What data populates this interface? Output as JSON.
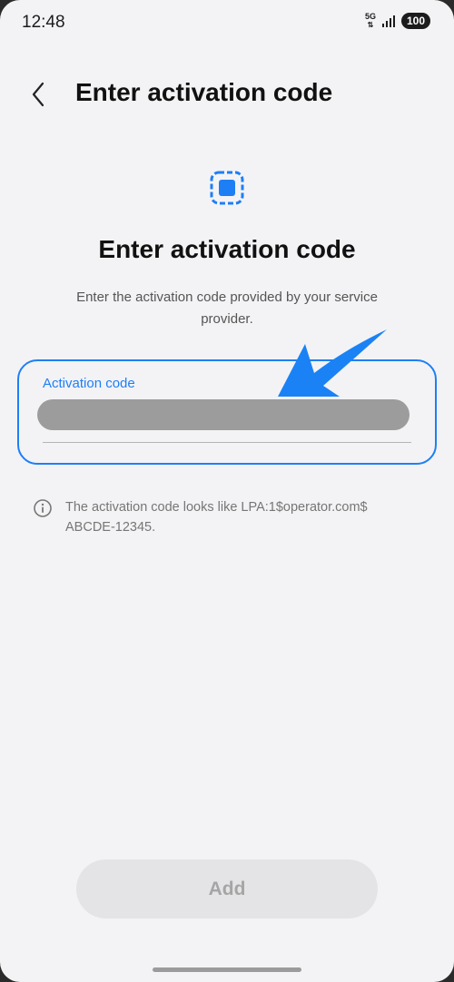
{
  "status_bar": {
    "time": "12:48",
    "network_type": "5G",
    "battery": "100"
  },
  "header": {
    "title": "Enter activation code"
  },
  "content": {
    "title": "Enter activation code",
    "description": "Enter the activation code provided by your service provider.",
    "input": {
      "label": "Activation code",
      "value": ""
    },
    "hint": {
      "line1": "The activation code looks like LPA:1$operator.com$",
      "line2": "ABCDE-12345."
    }
  },
  "footer": {
    "add_button_label": "Add"
  },
  "colors": {
    "accent": "#1e7ff5",
    "background": "#f3f3f5",
    "disabled_text": "#a5a5a5"
  },
  "icons": {
    "back": "chevron-left-icon",
    "esim": "esim-chip-icon",
    "info": "info-icon",
    "pointer": "arrow-annotation-icon"
  }
}
